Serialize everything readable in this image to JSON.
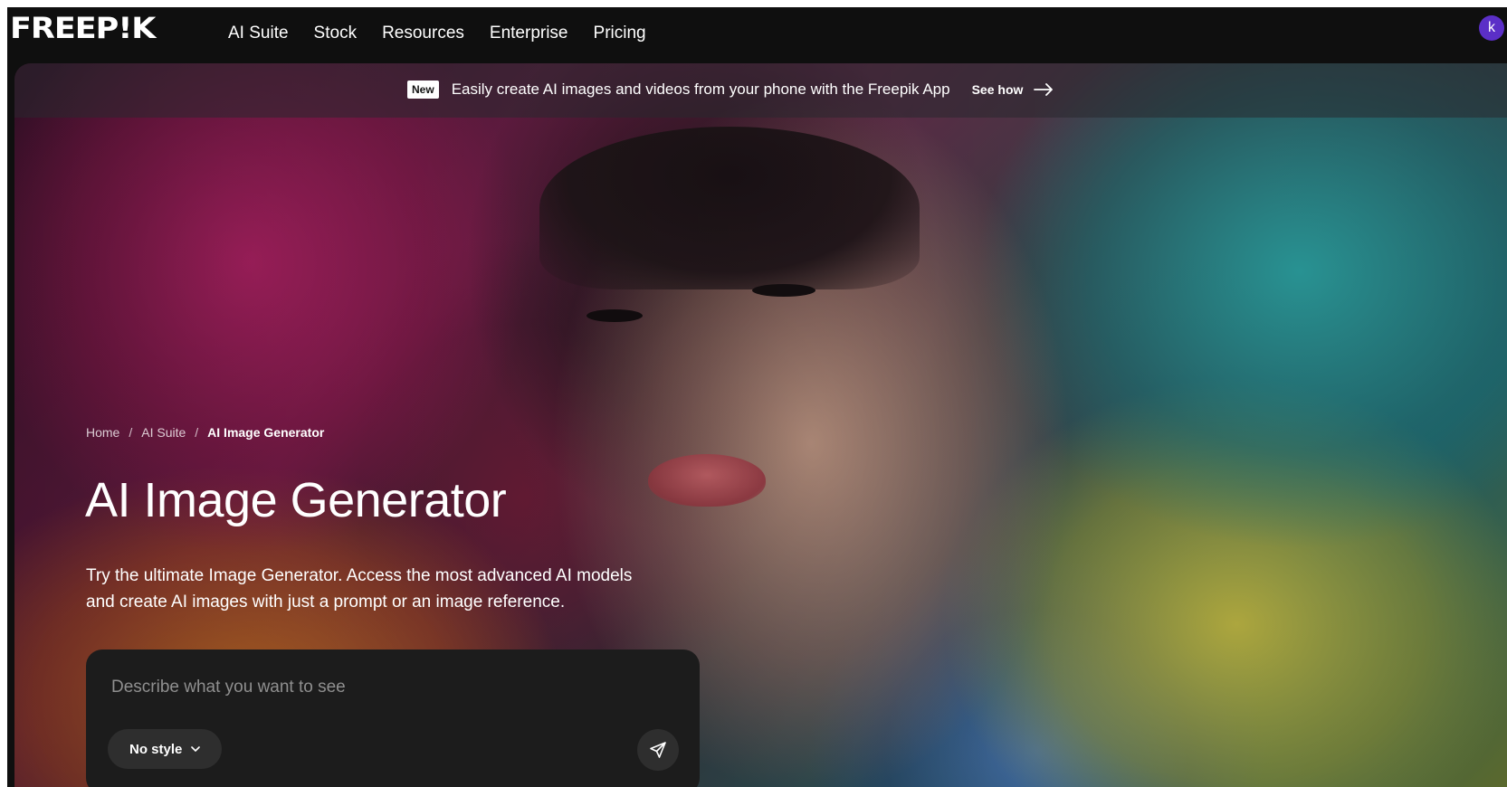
{
  "brand": {
    "logo_text": "FREEP!K"
  },
  "nav": {
    "items": [
      {
        "label": "AI Suite"
      },
      {
        "label": "Stock"
      },
      {
        "label": "Resources"
      },
      {
        "label": "Enterprise"
      },
      {
        "label": "Pricing"
      }
    ]
  },
  "user": {
    "avatar_initial": "k",
    "avatar_color": "#5b2fc7"
  },
  "announcement": {
    "badge": "New",
    "text": "Easily create AI images and videos from your phone with the Freepik App",
    "cta": "See how"
  },
  "breadcrumb": {
    "home": "Home",
    "parent": "AI Suite",
    "current": "AI Image Generator",
    "separator": "/"
  },
  "hero": {
    "title": "AI Image Generator",
    "description": "Try the ultimate Image Generator. Access the most advanced AI models and create AI images with just a prompt or an image reference."
  },
  "prompt": {
    "placeholder": "Describe what you want to see",
    "value": "",
    "style_label": "No style"
  },
  "icons": {
    "arrow": "arrow-right-icon",
    "chevron": "chevron-down-icon",
    "send": "send-icon"
  }
}
